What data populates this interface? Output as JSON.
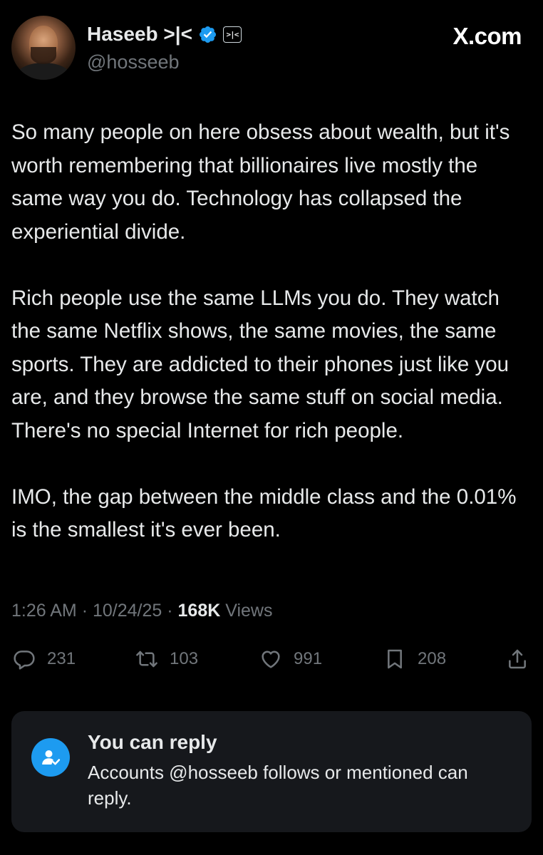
{
  "brand": {
    "label": "X.com"
  },
  "author": {
    "display_name": "Haseeb >|<",
    "handle": "@hosseeb",
    "affiliate_badge": ">|<",
    "verified_color": "#1d9bf0"
  },
  "tweet": {
    "paragraphs": [
      "So many people on here obsess about wealth, but it's worth remembering that billionaires live mostly the same way you do. Technology has collapsed the experiential divide.",
      "Rich people use the same LLMs you do. They watch the same Netflix shows, the same movies, the same sports. They are addicted to their phones just like you are, and they browse the same stuff on social media. There's no special Internet for rich people.",
      "IMO, the gap between the middle class and the 0.01% is the smallest it's ever been."
    ],
    "time": "1:26 AM",
    "date": "10/24/25",
    "separator": "·",
    "views_count": "168K",
    "views_label": "Views"
  },
  "actions": {
    "replies": {
      "icon": "reply-icon",
      "count": "231"
    },
    "reposts": {
      "icon": "repost-icon",
      "count": "103"
    },
    "likes": {
      "icon": "heart-icon",
      "count": "991"
    },
    "bookmarks": {
      "icon": "bookmark-icon",
      "count": "208"
    },
    "share": {
      "icon": "share-icon"
    }
  },
  "reply_notice": {
    "icon": "user-check-icon",
    "title": "You can reply",
    "description": "Accounts @hosseeb follows or mentioned can reply."
  },
  "colors": {
    "background": "#000000",
    "text_primary": "#e7e9ea",
    "text_secondary": "#71767b",
    "accent": "#1d9bf0",
    "card_background": "#16181c"
  }
}
